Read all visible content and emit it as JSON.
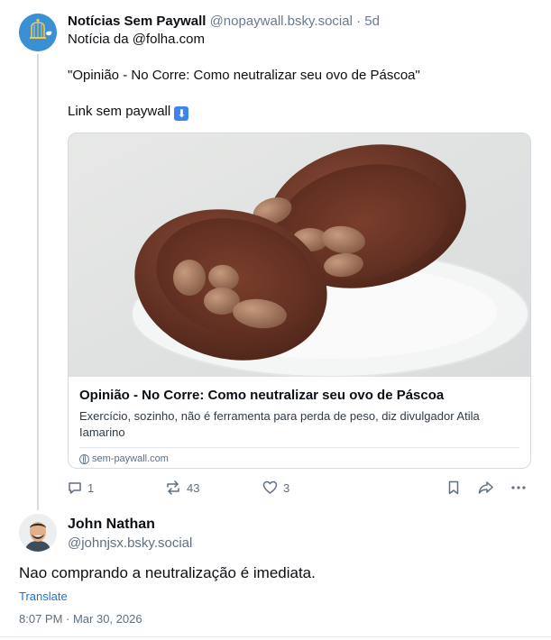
{
  "post": {
    "author_name": "Notícias Sem Paywall",
    "author_handle": "@nopaywall.bsky.social",
    "separator": "·",
    "age": "5d",
    "line1": "Notícia da @folha.com",
    "line2": "\"Opinião - No Corre: Como neutralizar seu ovo de Páscoa\"",
    "line3": "Link sem paywall",
    "line3_emoji": "⬇",
    "avatar_icon": "bird-in-cage-icon"
  },
  "card": {
    "image_icon": "chocolate-easter-egg-image",
    "title": "Opinião - No Corre: Como neutralizar seu ovo de Páscoa",
    "description": "Exercício, sozinho, não é ferramenta para perda de peso, diz divulgador Atila Iamarino",
    "domain": "sem-paywall.com"
  },
  "actions": {
    "reply_count": "1",
    "repost_count": "43",
    "like_count": "3"
  },
  "reply": {
    "author_name": "John Nathan",
    "author_handle": "@johnjsx.bsky.social",
    "text": "Nao comprando a neutralização é imediata.",
    "translate_label": "Translate",
    "timestamp": "8:07 PM · Mar 30, 2026"
  },
  "colors": {
    "link": "#1d72d8",
    "muted": "#6a7a8a",
    "border": "#d4dbe2"
  }
}
